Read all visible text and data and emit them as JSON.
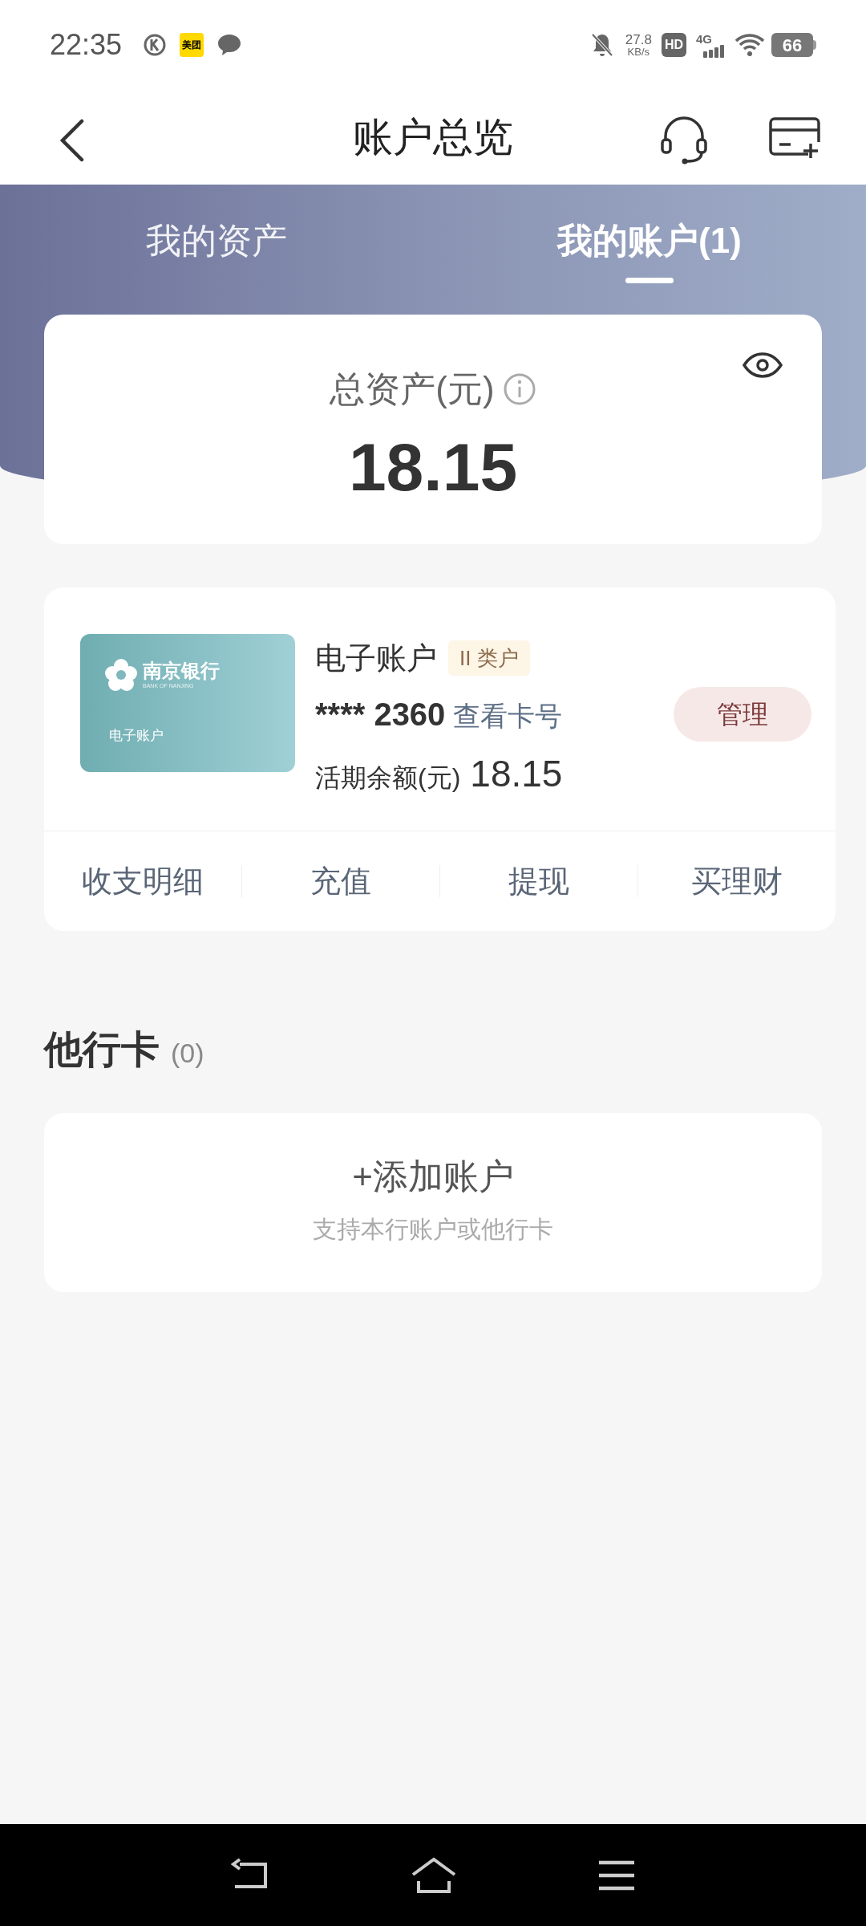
{
  "status_bar": {
    "time": "22:35",
    "app_badge": "美团",
    "net_speed": "27.8",
    "net_unit": "KB/s",
    "hd": "HD",
    "network": "4G",
    "battery": "66"
  },
  "header": {
    "title": "账户总览"
  },
  "tabs": [
    {
      "label": "我的资产",
      "selected": false
    },
    {
      "label": "我的账户(1)",
      "selected": true
    }
  ],
  "total": {
    "label": "总资产(元)",
    "amount": "18.15"
  },
  "account": {
    "card_bank": "南京银行",
    "card_bank_en": "BANK OF NANJING",
    "card_label": "电子账户",
    "name": "电子账户",
    "tag": "II 类户",
    "masked": "****",
    "last4": "2360",
    "view_link": "查看卡号",
    "balance_label": "活期余额(元)",
    "balance": "18.15",
    "manage": "管理",
    "actions": [
      "收支明细",
      "充值",
      "提现",
      "买理财"
    ]
  },
  "other_cards": {
    "title": "他行卡",
    "count": "(0)",
    "add": "+添加账户",
    "hint": "支持本行账户或他行卡"
  }
}
